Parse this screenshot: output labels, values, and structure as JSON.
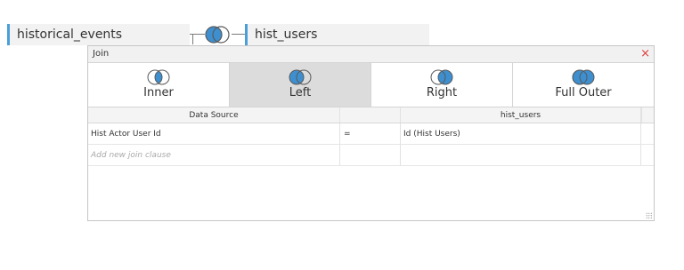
{
  "canvas": {
    "left_table": "historical_events",
    "right_table": "hist_users"
  },
  "dialog": {
    "title": "Join",
    "close_glyph": "×",
    "join_types": [
      {
        "label": "Inner",
        "icon": "inner-join-icon",
        "selected": false
      },
      {
        "label": "Left",
        "icon": "left-join-icon",
        "selected": true
      },
      {
        "label": "Right",
        "icon": "right-join-icon",
        "selected": false
      },
      {
        "label": "Full Outer",
        "icon": "full-outer-join-icon",
        "selected": false
      }
    ],
    "table": {
      "headers": [
        "Data Source",
        "",
        "hist_users"
      ],
      "rows": [
        {
          "left": "Hist Actor User Id",
          "operator": "=",
          "right": "Id (Hist Users)"
        }
      ],
      "add_clause_placeholder": "Add new join clause"
    }
  },
  "colors": {
    "accent": "#4a9fd8",
    "join_fill": "#3d8fd0",
    "selected_bg": "#dcdcdc",
    "close": "#e03c3c"
  }
}
